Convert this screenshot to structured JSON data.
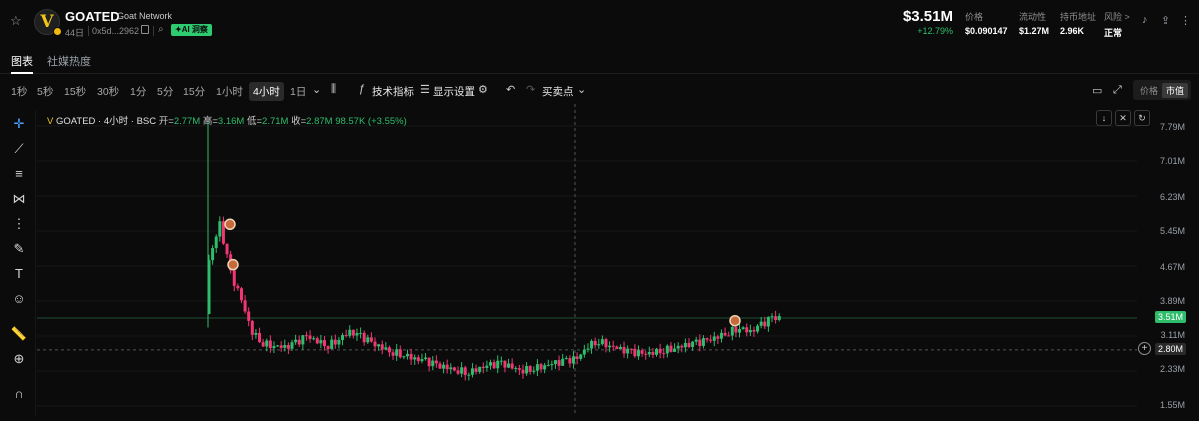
{
  "token": {
    "logo_letter": "V",
    "name": "GOATED",
    "subtitle": "Goat Network",
    "age": "44日",
    "address": "0x5d...2962",
    "ai_badge": "✦AI 洞察"
  },
  "price": {
    "current": "$3.51M",
    "change": "+12.79%"
  },
  "stats": [
    {
      "label": "价格",
      "value": "$0.090147"
    },
    {
      "label": "流动性",
      "value": "$1.27M"
    },
    {
      "label": "持币地址",
      "value": "2.96K"
    },
    {
      "label": "风险 >",
      "value": "正常"
    }
  ],
  "tabs": [
    {
      "label": "图表",
      "active": true
    },
    {
      "label": "社媒热度",
      "active": false
    }
  ],
  "intervals": [
    "1秒",
    "5秒",
    "15秒",
    "30秒",
    "1分",
    "5分",
    "15分",
    "1小时",
    "4小时",
    "1日"
  ],
  "active_interval": "4小时",
  "toolbar": {
    "indicators": "技术指标",
    "display_settings": "显示设置",
    "trade_points": "买卖点",
    "toggle_price": "价格",
    "toggle_mcap": "市值"
  },
  "legend": {
    "title": "GOATED · 4小时 · BSC",
    "open_label": "开=",
    "open": "2.77M",
    "high_label": "高=",
    "high": "3.16M",
    "low_label": "低=",
    "low": "2.71M",
    "close_label": "收=",
    "close": "2.87M",
    "volume": "98.57K (+3.55%)"
  },
  "axis": {
    "ticks": [
      "7.79M",
      "7.01M",
      "6.23M",
      "5.45M",
      "4.67M",
      "3.89M",
      "3.11M",
      "2.33M",
      "1.55M"
    ],
    "current_tag": "3.51M",
    "crosshair_tag": "2.80M"
  },
  "colors": {
    "up": "#2ebd6b",
    "down": "#f23674",
    "accent_green": "#2ecc71"
  },
  "chart_data": {
    "type": "candlestick",
    "y_unit": "market cap (M)",
    "ylim": [
      1.55,
      7.79
    ],
    "close_series": [
      4.8,
      5.6,
      4.5,
      3.9,
      3.2,
      2.95,
      2.9,
      2.85,
      2.95,
      3.1,
      3.0,
      2.9,
      3.05,
      3.2,
      3.1,
      2.95,
      2.85,
      2.75,
      2.7,
      2.6,
      2.55,
      2.45,
      2.4,
      2.35,
      2.3,
      2.4,
      2.45,
      2.5,
      2.4,
      2.35,
      2.4,
      2.45,
      2.5,
      2.55,
      2.6,
      2.9,
      3.0,
      2.9,
      2.8,
      2.75,
      2.7,
      2.75,
      2.8,
      2.85,
      2.9,
      2.95,
      3.0,
      3.1,
      3.2,
      3.3,
      3.2,
      3.35,
      3.51
    ]
  }
}
